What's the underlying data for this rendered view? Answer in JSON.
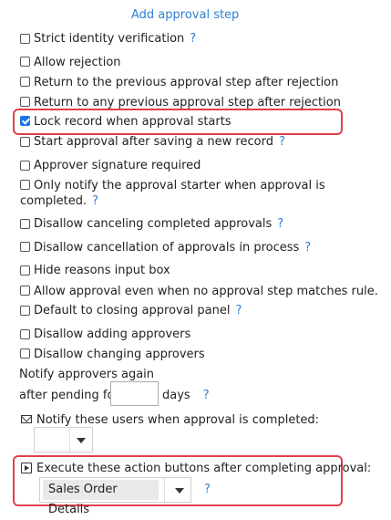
{
  "header": {
    "add_step_label": "Add approval step"
  },
  "help_glyph": "?",
  "options": [
    {
      "label": "Strict identity verification",
      "checked": false,
      "help": true
    },
    {
      "label": "Allow rejection",
      "checked": false,
      "help": false
    },
    {
      "label": "Return to the previous approval step after rejection",
      "checked": false,
      "help": false
    },
    {
      "label": "Return to any previous approval step after rejection",
      "checked": false,
      "help": false
    },
    {
      "label": "Lock record when approval starts",
      "checked": true,
      "help": false
    },
    {
      "label": "Start approval after saving a new record",
      "checked": false,
      "help": true
    },
    {
      "label": "Approver signature required",
      "checked": false,
      "help": false
    },
    {
      "label_line1": "Only notify the approval starter when approval is",
      "label_line2": "completed.",
      "checked": false,
      "help": true
    },
    {
      "label": "Disallow canceling completed approvals",
      "checked": false,
      "help": true
    },
    {
      "label": "Disallow cancellation of approvals in process",
      "checked": false,
      "help": true
    },
    {
      "label": "Hide reasons input box",
      "checked": false,
      "help": false
    },
    {
      "label": "Allow approval even when no approval step matches rule.",
      "checked": false,
      "help": false
    },
    {
      "label": "Default to closing approval panel",
      "checked": false,
      "help": true
    },
    {
      "label": "Disallow adding approvers",
      "checked": false,
      "help": false
    },
    {
      "label": "Disallow changing approvers",
      "checked": false,
      "help": false
    }
  ],
  "notify_again": {
    "line1": "Notify approvers again",
    "prefix": "after pending for",
    "value": "",
    "suffix": "days"
  },
  "notify_users": {
    "label": "Notify these users when approval is completed:"
  },
  "action_buttons": {
    "label": "Execute these action buttons after completing approval:",
    "selected": "Sales Order Details"
  },
  "icons": {
    "notify_users": "envelope-icon",
    "action_buttons": "play-square-icon",
    "dropdown": "caret-down-icon"
  },
  "colors": {
    "link": "#2f7fd1",
    "highlight": "#e0404a",
    "checkbox_checked": "#1a73e8"
  }
}
